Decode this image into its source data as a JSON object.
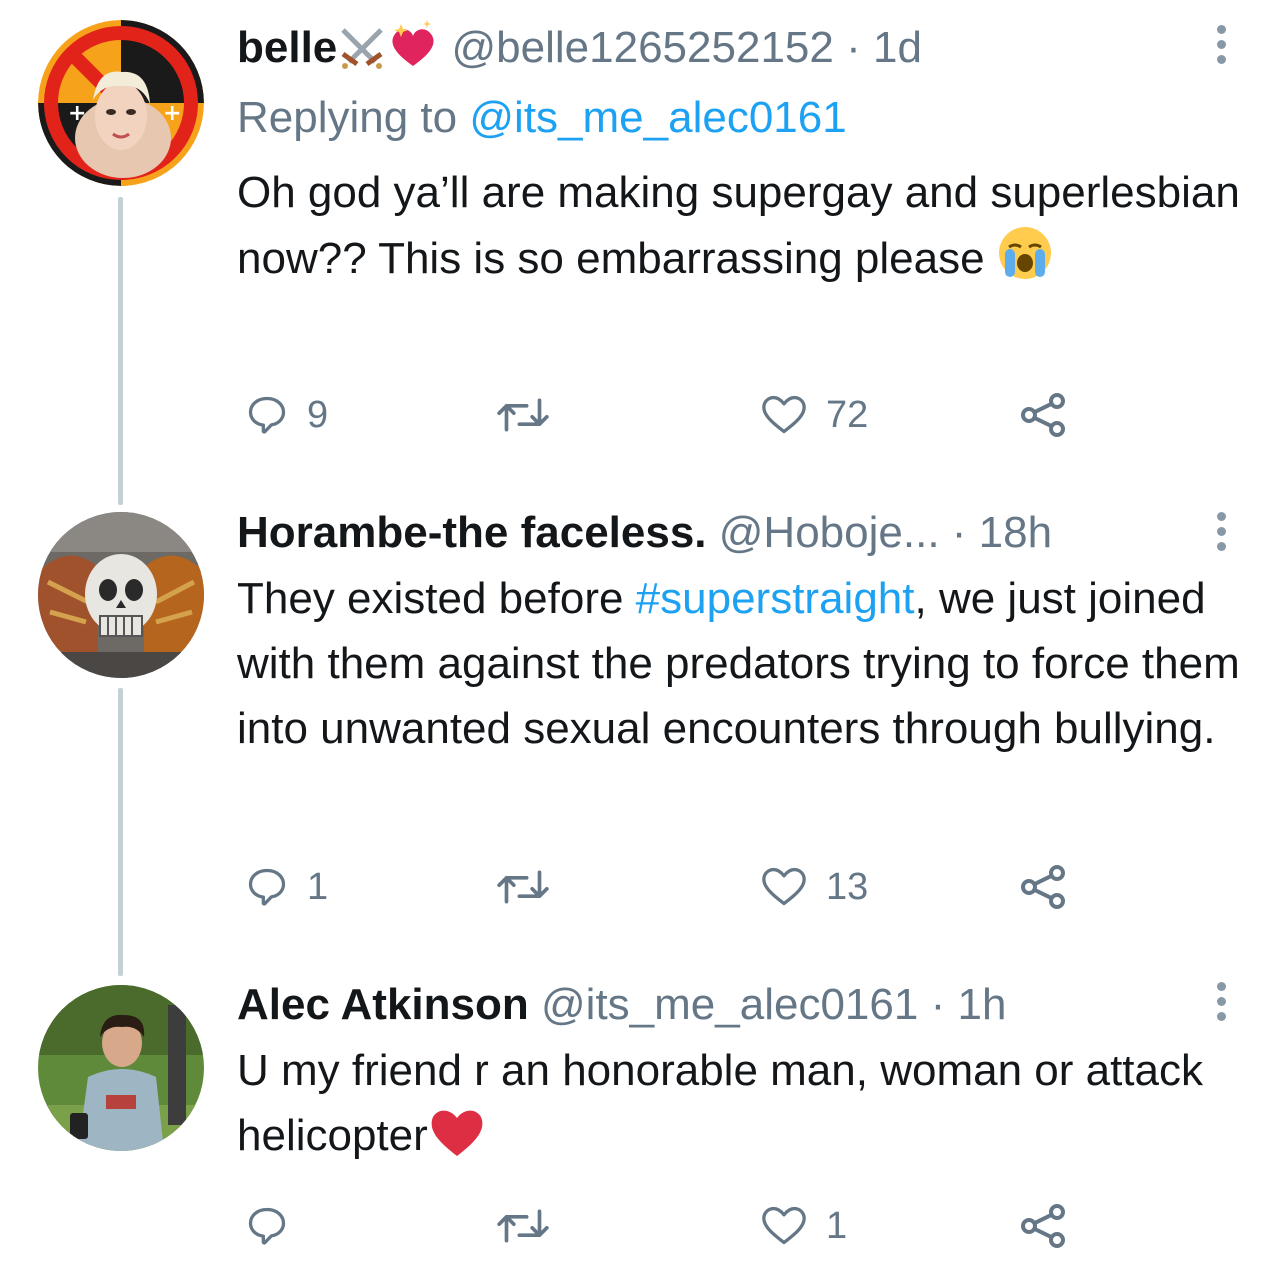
{
  "tweets": [
    {
      "display_name": "belle",
      "name_emoji": [
        "crossed-swords-icon",
        "sparkling-heart-icon"
      ],
      "handle": "@belle1265252152",
      "separator": "·",
      "time": "1d",
      "replying_to_label": "Replying to",
      "replying_to_handle": "@its_me_alec0161",
      "text": "Oh god ya’ll are making supergay and superlesbian now?? This is so embarrassing please",
      "text_emoji": "loudly-crying-face-icon",
      "reply_count": "9",
      "retweet_count": "",
      "like_count": "72"
    },
    {
      "display_name": "Horambe-the faceless.",
      "handle": "@Hoboje...",
      "separator": "·",
      "time": "18h",
      "text_before_hashtag": "They existed before ",
      "hashtag": "#superstraight",
      "text_after_hashtag": ", we just joined with them against the predators trying to force them into unwanted sexual encounters through bullying.",
      "reply_count": "1",
      "retweet_count": "",
      "like_count": "13"
    },
    {
      "display_name": "Alec Atkinson",
      "handle": "@its_me_alec0161",
      "separator": "·",
      "time": "1h",
      "text": "U my friend r an honorable man, woman or attack helicopter",
      "text_emoji": "red-heart-icon",
      "reply_count": "",
      "retweet_count": "",
      "like_count": "1"
    }
  ],
  "colors": {
    "text": "#14171a",
    "secondary": "#657786",
    "link": "#1da1f2",
    "thread_line": "#c4cfd6",
    "heart_red": "#e0245e"
  }
}
